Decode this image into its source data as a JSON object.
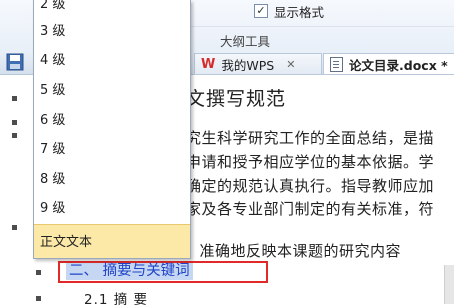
{
  "ribbon": {
    "show_format_label": "显示格式",
    "show_format_checked": true,
    "group_label": "大纲工具"
  },
  "tabs": [
    {
      "label": "我的WPS",
      "icon": "wps-w-icon"
    },
    {
      "label": "论文目录.docx *",
      "icon": "document-icon"
    }
  ],
  "dropdown": {
    "items": [
      "2 级",
      "3 级",
      "4 级",
      "5 级",
      "6 级",
      "7 级",
      "8 级",
      "9 级"
    ],
    "body_text_item": "正文文本",
    "highlight_color": "#fde9a7"
  },
  "document": {
    "heading": "文撰写规范",
    "lines": [
      "究生科学研究工作的全面总结，是描",
      "申请和授予相应学位的基本依据。学",
      "确定的规范认真执行。指导教师应加",
      "家及各专业部门制定的有关标准，符"
    ],
    "continuation_line": "题目应恰当、简明、准确地反映本课题的研究内容",
    "section_2": "二、 摘要与关键词",
    "subsection_2_1": "2.1 摘  要",
    "selection_color": "#c5d7f3",
    "box_color": "#e02a2a"
  }
}
